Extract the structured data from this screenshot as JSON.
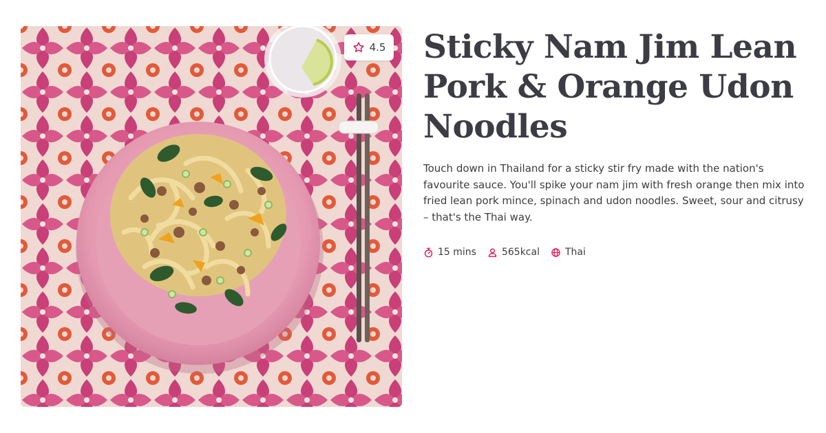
{
  "recipe": {
    "title": "Sticky Nam Jim Lean Pork & Orange Udon Noodles",
    "description": "Touch down in Thailand for a sticky stir fry made with the nation's favourite sauce. You'll spike your nam jim with fresh orange then mix into fried lean pork mince, spinach and udon noodles. Sweet, sour and citrusy – that's the Thai way.",
    "rating": {
      "value": "4.5",
      "icon": "star-icon"
    },
    "meta": [
      {
        "icon": "stopwatch-icon",
        "label": "15 mins"
      },
      {
        "icon": "person-icon",
        "label": "565kcal"
      },
      {
        "icon": "globe-icon",
        "label": "Thai"
      }
    ],
    "image": {
      "subject": "pink bowl of udon noodles with pork, orange, spinach and spring onion on a patterned pink and orange tablecloth, with a glass of water and chopsticks"
    }
  },
  "colors": {
    "accent": "#e4104d",
    "title": "#3c3c44",
    "text": "#3d3d3d",
    "tablecloth": "#e8a6bd",
    "bowl": "#e8a2b6"
  }
}
